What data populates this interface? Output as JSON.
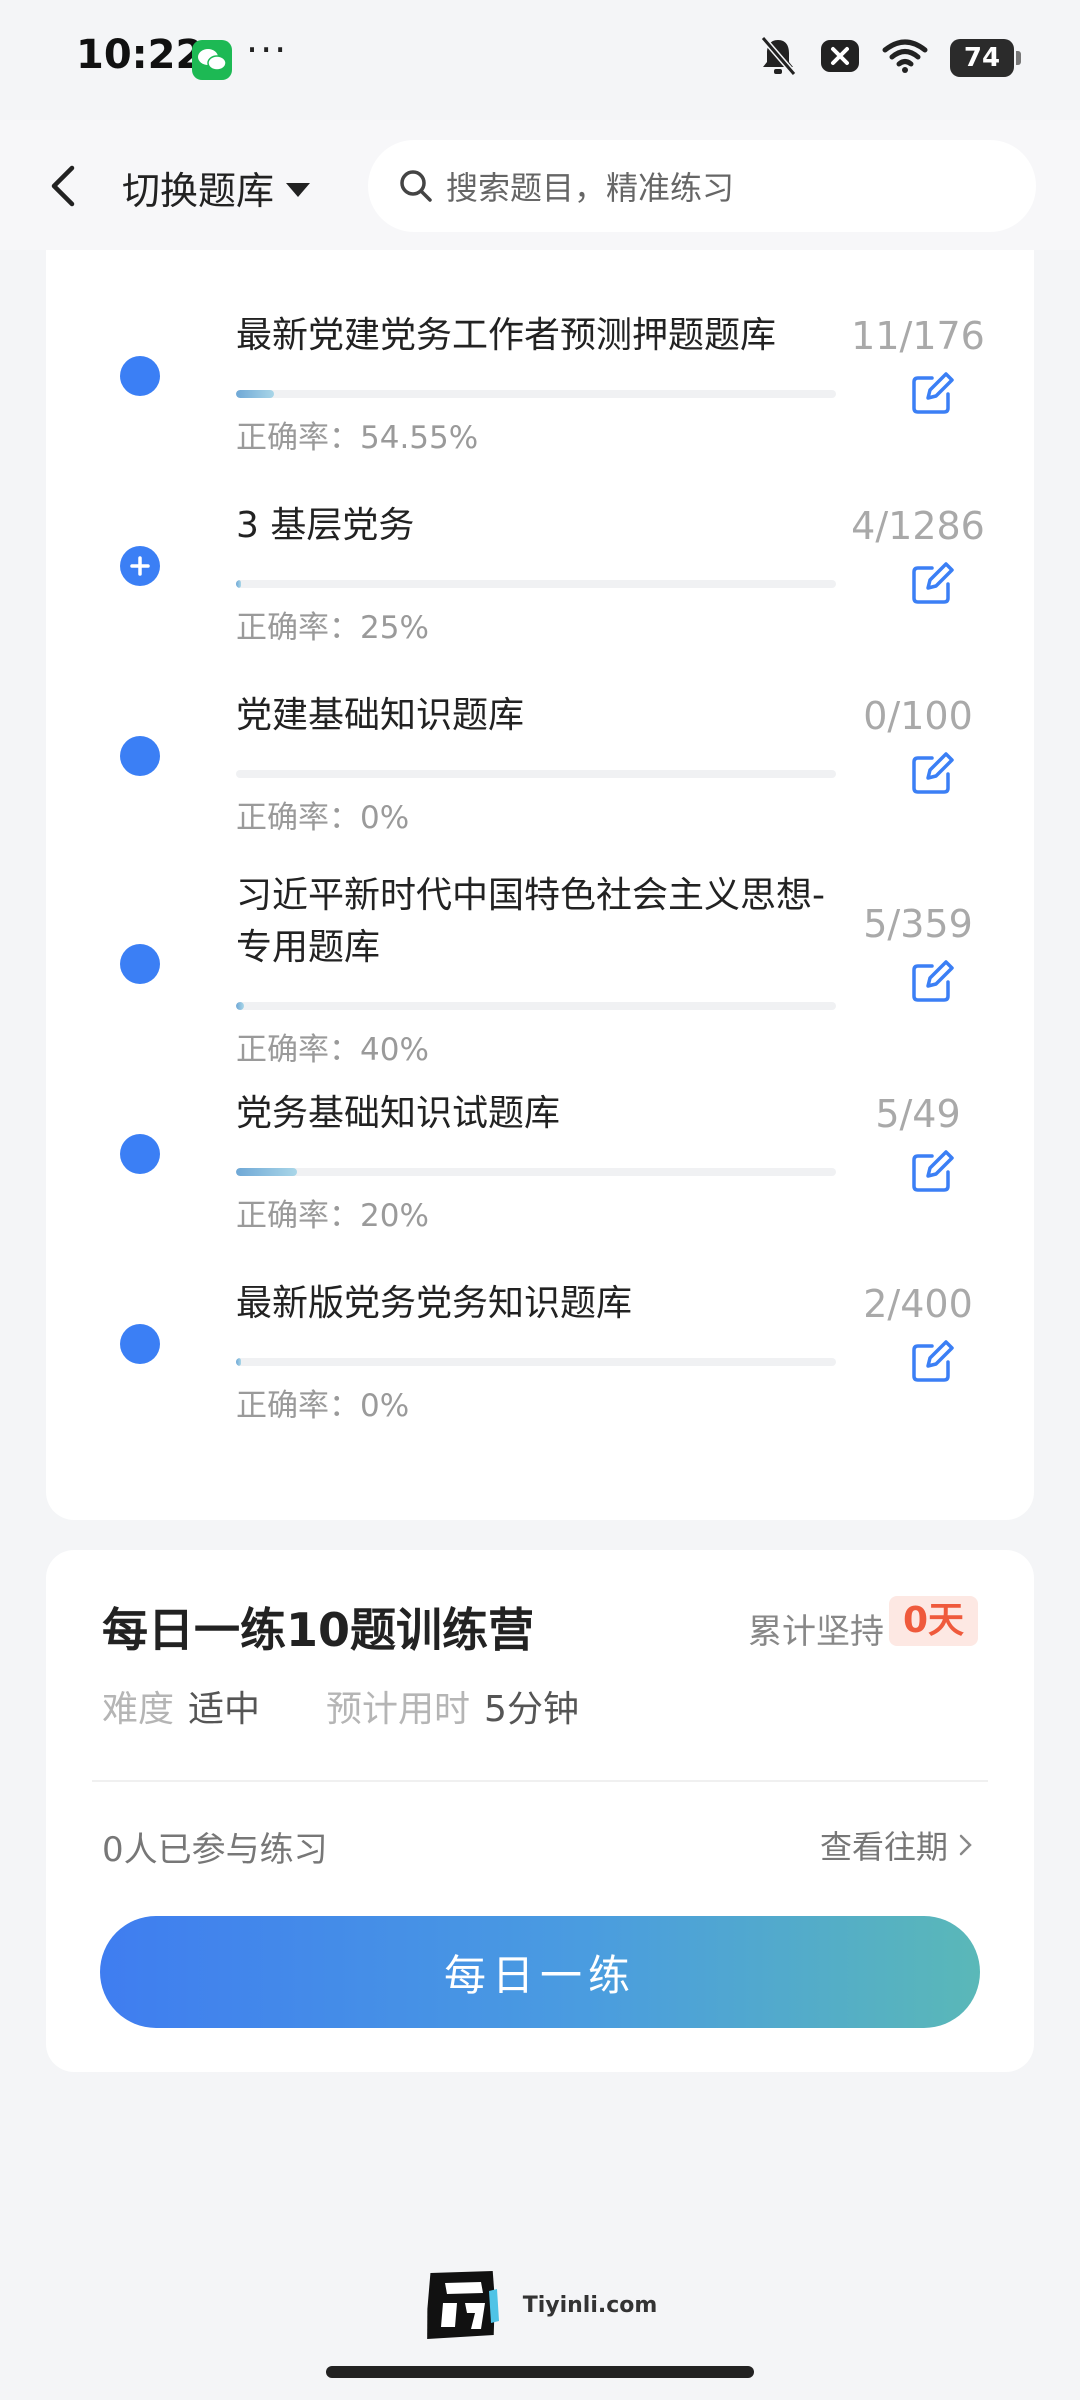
{
  "status_bar": {
    "time": "10:22",
    "more": "···",
    "battery": "74"
  },
  "nav": {
    "switch_label": "切换题库",
    "search_placeholder": "搜索题目，精准练习"
  },
  "banks": [
    {
      "title": "最新党建党务工作者预测押题题库",
      "accuracy": "正确率：54.55%",
      "count": "11/176",
      "progress": 0.0625,
      "icon": "dot"
    },
    {
      "title": "3 基层党务",
      "accuracy": "正确率：25%",
      "count": "4/1286",
      "progress": 0.003,
      "icon": "plus"
    },
    {
      "title": "党建基础知识题库",
      "accuracy": "正确率：0%",
      "count": "0/100",
      "progress": 0,
      "icon": "dot"
    },
    {
      "title": "习近平新时代中国特色社会主义思想-专用题库",
      "accuracy": "正确率：40%",
      "count": "5/359",
      "progress": 0.014,
      "icon": "dot"
    },
    {
      "title": "党务基础知识试题库",
      "accuracy": "正确率：20%",
      "count": "5/49",
      "progress": 0.102,
      "icon": "dot"
    },
    {
      "title": "最新版党务党务知识题库",
      "accuracy": "正确率：0%",
      "count": "2/400",
      "progress": 0.005,
      "icon": "dot"
    }
  ],
  "daily": {
    "title": "每日一练10题训练营",
    "streak_label": "累计坚持",
    "streak_value": "0天",
    "difficulty_label": "难度",
    "difficulty_value": "适中",
    "time_label": "预计用时",
    "time_value": "5分钟",
    "participants": "0人已参与练习",
    "history_link": "查看往期",
    "button": "每日一练"
  },
  "footer": {
    "brand": "Tiyinli.com"
  },
  "colors": {
    "accent": "#3b7ff5",
    "streak": "#ef5a3c"
  }
}
